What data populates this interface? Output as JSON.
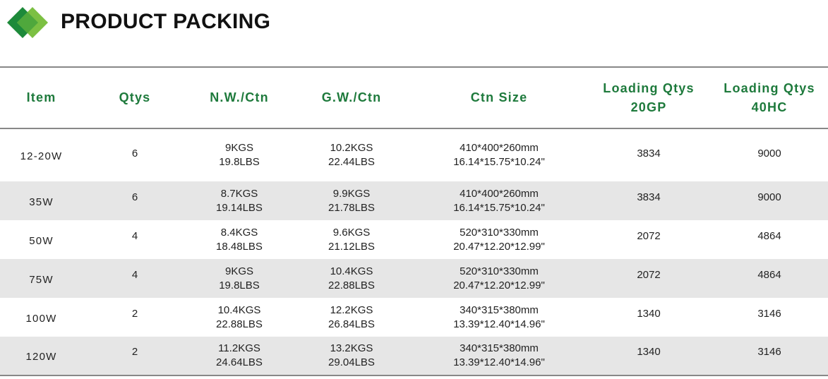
{
  "header": {
    "title": "PRODUCT PACKING",
    "logo_icon": "green-diamond-logo-icon",
    "logo_colors": [
      "#1d8a3a",
      "#7cc043"
    ]
  },
  "colors": {
    "header_text": "#1e7a3c",
    "alt_row_bg": "#e6e6e6",
    "rule": "#888888"
  },
  "table": {
    "columns": [
      {
        "line1": "Item",
        "line2": ""
      },
      {
        "line1": "Qtys",
        "line2": ""
      },
      {
        "line1": "N.W./Ctn",
        "line2": ""
      },
      {
        "line1": "G.W./Ctn",
        "line2": ""
      },
      {
        "line1": "Ctn Size",
        "line2": ""
      },
      {
        "line1": "Loading Qtys",
        "line2": "20GP"
      },
      {
        "line1": "Loading Qtys",
        "line2": "40HC"
      }
    ],
    "rows": [
      {
        "item": "12-20W",
        "qtys": "6",
        "nw_kg": "9KGS",
        "nw_lb": "19.8LBS",
        "gw_kg": "10.2KGS",
        "gw_lb": "22.44LBS",
        "size_mm": "410*400*260mm",
        "size_in": "16.14*15.75*10.24\"",
        "q20gp": "3834",
        "q40hc": "9000"
      },
      {
        "item": "35W",
        "qtys": "6",
        "nw_kg": "8.7KGS",
        "nw_lb": "19.14LBS",
        "gw_kg": "9.9KGS",
        "gw_lb": "21.78LBS",
        "size_mm": "410*400*260mm",
        "size_in": "16.14*15.75*10.24\"",
        "q20gp": "3834",
        "q40hc": "9000"
      },
      {
        "item": "50W",
        "qtys": "4",
        "nw_kg": "8.4KGS",
        "nw_lb": "18.48LBS",
        "gw_kg": "9.6KGS",
        "gw_lb": "21.12LBS",
        "size_mm": "520*310*330mm",
        "size_in": "20.47*12.20*12.99\"",
        "q20gp": "2072",
        "q40hc": "4864"
      },
      {
        "item": "75W",
        "qtys": "4",
        "nw_kg": "9KGS",
        "nw_lb": "19.8LBS",
        "gw_kg": "10.4KGS",
        "gw_lb": "22.88LBS",
        "size_mm": "520*310*330mm",
        "size_in": "20.47*12.20*12.99\"",
        "q20gp": "2072",
        "q40hc": "4864"
      },
      {
        "item": "100W",
        "qtys": "2",
        "nw_kg": "10.4KGS",
        "nw_lb": "22.88LBS",
        "gw_kg": "12.2KGS",
        "gw_lb": "26.84LBS",
        "size_mm": "340*315*380mm",
        "size_in": "13.39*12.40*14.96\"",
        "q20gp": "1340",
        "q40hc": "3146"
      },
      {
        "item": "120W",
        "qtys": "2",
        "nw_kg": "11.2KGS",
        "nw_lb": "24.64LBS",
        "gw_kg": "13.2KGS",
        "gw_lb": "29.04LBS",
        "size_mm": "340*315*380mm",
        "size_in": "13.39*12.40*14.96\"",
        "q20gp": "1340",
        "q40hc": "3146"
      }
    ]
  }
}
